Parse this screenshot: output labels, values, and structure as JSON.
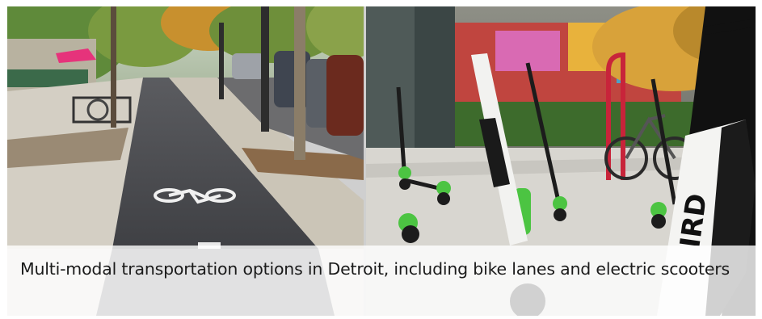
{
  "caption": {
    "text": "Multi-modal transportation options in Detroit, including bike lanes and electric scooters"
  },
  "images": [
    {
      "name": "bike-lane-photo",
      "subject": "bike lane on city street"
    },
    {
      "name": "electric-scooters-photo",
      "subject": "electric scooters parked near bike rack"
    }
  ],
  "scooter_brand_text": "IRD",
  "colors": {
    "scooter_green": "#4cc442",
    "bike_lane_asphalt": "#4a4a4c",
    "caption_text": "#1b1b1b"
  }
}
